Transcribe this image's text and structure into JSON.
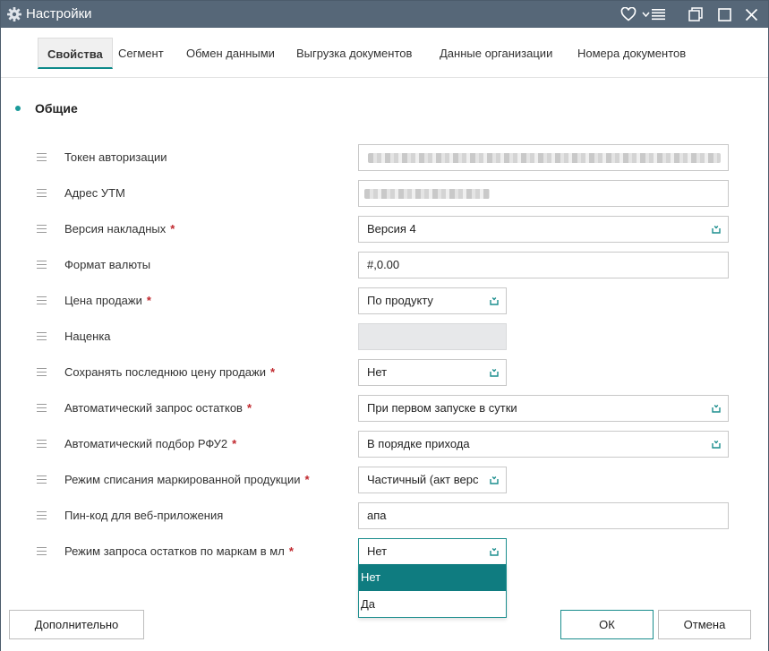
{
  "window": {
    "title": "Настройки"
  },
  "tabs": [
    "Свойства",
    "Сегмент",
    "Обмен данными",
    "Выгрузка документов",
    "Данные организации",
    "Номера документов"
  ],
  "section": {
    "title": "Общие"
  },
  "fields": [
    {
      "label": "Токен авторизации",
      "required": false,
      "value": ""
    },
    {
      "label": "Адрес УТМ",
      "required": false,
      "value": ""
    },
    {
      "label": "Версия накладных",
      "required": true,
      "value": "Версия 4"
    },
    {
      "label": "Формат валюты",
      "required": false,
      "value": "#,0.00"
    },
    {
      "label": "Цена продажи",
      "required": true,
      "value": "По продукту"
    },
    {
      "label": "Наценка",
      "required": false,
      "value": ""
    },
    {
      "label": "Сохранять последнюю цену продажи",
      "required": true,
      "value": "Нет"
    },
    {
      "label": "Автоматический запрос остатков",
      "required": true,
      "value": "При первом запуске в сутки"
    },
    {
      "label": "Автоматический подбор РФУ2",
      "required": true,
      "value": "В порядке прихода"
    },
    {
      "label": "Режим списания маркированной продукции",
      "required": true,
      "value": "Частичный (акт верс"
    },
    {
      "label": "Пин-код для веб-приложения",
      "required": false,
      "value": "апа"
    },
    {
      "label": "Режим запроса остатков по маркам в мл",
      "required": true,
      "value": "Нет"
    }
  ],
  "required_mark": "*",
  "dropdown": {
    "options": [
      "Нет",
      "Да"
    ],
    "selected": "Нет"
  },
  "footer": {
    "more_label": "Дополнительно",
    "ok_label": "ОК",
    "cancel_label": "Отмена"
  },
  "colors": {
    "titlebar": "#566778",
    "accent": "#0f7c80",
    "required": "#c0272d"
  }
}
